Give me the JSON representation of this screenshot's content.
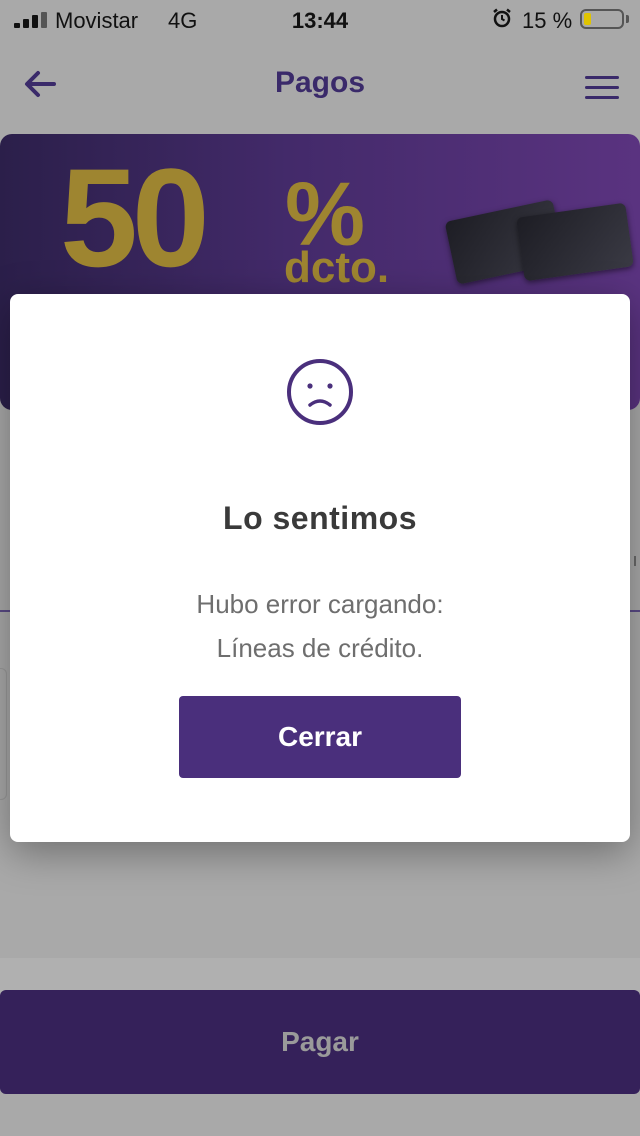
{
  "status_bar": {
    "carrier": "Movistar",
    "network": "4G",
    "time": "13:44",
    "battery_percent": "15 %"
  },
  "header": {
    "title": "Pagos",
    "back_icon": "arrow-left-icon",
    "menu_icon": "hamburger-menu-icon"
  },
  "banner": {
    "discount_value": "50",
    "discount_symbol": "%",
    "discount_label": "dcto."
  },
  "modal": {
    "icon": "sad-face-icon",
    "title": "Lo sentimos",
    "message_line1": "Hubo error cargando:",
    "message_line2": "Líneas de crédito.",
    "close_label": "Cerrar"
  },
  "footer": {
    "pay_label": "Pagar"
  },
  "colors": {
    "brand_purple": "#4a2f7c",
    "title_purple": "#3a2a6a",
    "promo_gold": "#9e8530"
  }
}
